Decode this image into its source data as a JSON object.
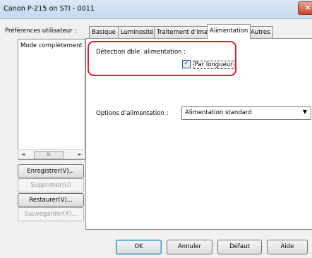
{
  "window": {
    "title": "Canon P-215 on STI - 0011",
    "close_label": "×"
  },
  "preferences": {
    "label": "Préférences utilisateur :",
    "items": [
      "Mode complètement au"
    ],
    "scroll_left": "◄",
    "scroll_thumb": "III",
    "scroll_right": "►",
    "buttons": [
      {
        "label": "Enregistrer(V)...",
        "enabled": true
      },
      {
        "label": "Supprimer(U)",
        "enabled": false
      },
      {
        "label": "Restaurer(V)...",
        "enabled": true
      },
      {
        "label": "Sauvegarder(X)...",
        "enabled": false
      }
    ]
  },
  "tabs": [
    {
      "label": "Basique",
      "active": false
    },
    {
      "label": "Luminosité",
      "active": false
    },
    {
      "label": "Traitement d'image",
      "active": false
    },
    {
      "label": "Alimentation",
      "active": true
    },
    {
      "label": "Autres",
      "active": false
    }
  ],
  "feed": {
    "detection_label": "Détection dble. alimentation :",
    "checkbox_label": "Par longueur",
    "checkbox_checked": true,
    "checkbox_mark": "✓",
    "options_label": "Options d'alimentation :",
    "options_value": "Alimentation standard",
    "options_arrow": "▼"
  },
  "footer": {
    "ok": "OK",
    "cancel": "Annuler",
    "default": "Défaut",
    "help": "Aide"
  },
  "colors": {
    "highlight": "#e8192c",
    "active_tab_bg": "#ffffff"
  }
}
